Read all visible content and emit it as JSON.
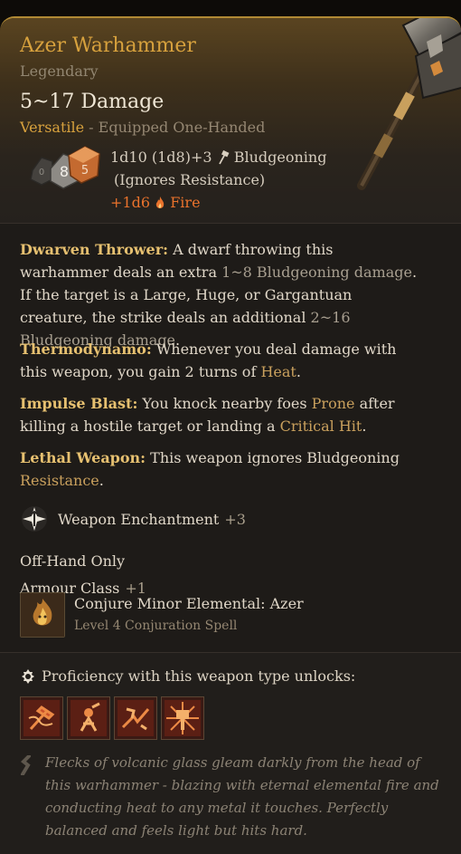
{
  "item": {
    "name": "Azer Warhammer",
    "rarity": "Legendary",
    "damage": "5~17 Damage",
    "versatile_label": "Versatile",
    "equipped_label": " - Equipped One-Handed",
    "damage_roll": "1d10 (1d8)+3",
    "damage_type": "Bludgeoning",
    "ignores": "(Ignores Resistance)",
    "bonus_damage": "+1d6",
    "bonus_type": "Fire"
  },
  "dice": {
    "d10_value": "0",
    "d8_value": "8",
    "d6_value": "5"
  },
  "colors": {
    "title_gold": "#d7a13d",
    "fire": "#e9722c",
    "keyword": "#c9a05d"
  },
  "properties": [
    {
      "name": "Dwarven Thrower:",
      "text_1": " A dwarf throwing this warhammer deals an extra ",
      "hl_1": "1~8 Bludgeoning damage",
      "text_2": ". If the target is a Large, Huge, or Gargantuan creature, the strike deals an additional ",
      "hl_2": "2~16 Bludgeoning damage",
      "text_3": "."
    },
    {
      "name": "Thermodynamo:",
      "text_1": " Whenever you deal damage with this weapon, you gain 2 turns of ",
      "hl_1": " Heat",
      "text_2": "."
    },
    {
      "name": "Impulse Blast:",
      "text_1": " You knock nearby foes ",
      "hl_1": "Prone",
      "text_2": " after killing a hostile target or landing a ",
      "hl_2": "Critical Hit",
      "text_3": "."
    },
    {
      "name": "Lethal Weapon:",
      "text_1": " This weapon ignores Bludgeoning ",
      "hl_1": "Resistance",
      "text_2": "."
    }
  ],
  "enchantment": {
    "label": "Weapon Enchantment",
    "value": "+3",
    "icon": "enchantment-icon"
  },
  "offhand": "Off-Hand Only",
  "armour": {
    "label": "Armour Class",
    "value": "+1"
  },
  "spell": {
    "name": "Conjure Minor Elemental: Azer",
    "detail": "Level 4 Conjuration Spell",
    "icon": "fire-elemental-icon"
  },
  "proficiency": {
    "label": "Proficiency with this weapon type unlocks:",
    "unlocks": [
      {
        "icon": "weapon-action-icon-1"
      },
      {
        "icon": "weapon-action-icon-2"
      },
      {
        "icon": "weapon-action-icon-3"
      },
      {
        "icon": "weapon-action-icon-4"
      }
    ]
  },
  "flavour": "Flecks of volcanic glass gleam darkly from the head of this warhammer - blazing with eternal elemental fire and conducting heat to any metal it touches. Perfectly balanced and feels light but hits hard."
}
